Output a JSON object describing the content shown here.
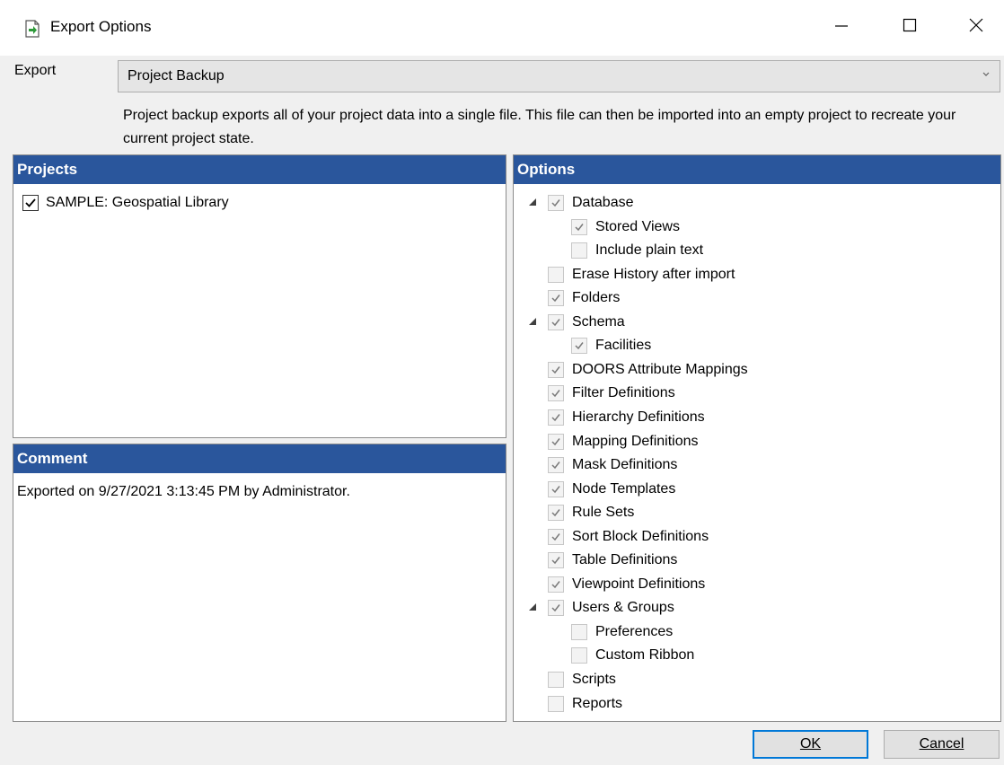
{
  "window": {
    "title": "Export Options",
    "icon": "export-document-icon",
    "minimize_icon": "minimize-icon",
    "maximize_icon": "maximize-icon",
    "close_icon": "close-icon"
  },
  "export": {
    "label": "Export",
    "selected": "Project Backup",
    "description": "Project backup exports all of your project data into a single file. This file can then be imported into an empty project to recreate your current project state."
  },
  "projects": {
    "header": "Projects",
    "items": [
      {
        "label": "SAMPLE: Geospatial Library",
        "checked": true
      }
    ]
  },
  "comment": {
    "header": "Comment",
    "text": "Exported on 9/27/2021 3:13:45 PM by Administrator."
  },
  "options": {
    "header": "Options",
    "items": [
      {
        "label": "Database",
        "checked": true,
        "level": 0,
        "expandable": true
      },
      {
        "label": "Stored Views",
        "checked": true,
        "level": 1,
        "expandable": false
      },
      {
        "label": "Include plain text",
        "checked": false,
        "level": 1,
        "expandable": false
      },
      {
        "label": "Erase History after import",
        "checked": false,
        "level": 0,
        "expandable": false
      },
      {
        "label": "Folders",
        "checked": true,
        "level": 0,
        "expandable": false
      },
      {
        "label": "Schema",
        "checked": true,
        "level": 0,
        "expandable": true
      },
      {
        "label": "Facilities",
        "checked": true,
        "level": 1,
        "expandable": false
      },
      {
        "label": "DOORS Attribute Mappings",
        "checked": true,
        "level": 0,
        "expandable": false
      },
      {
        "label": "Filter Definitions",
        "checked": true,
        "level": 0,
        "expandable": false
      },
      {
        "label": "Hierarchy Definitions",
        "checked": true,
        "level": 0,
        "expandable": false
      },
      {
        "label": "Mapping Definitions",
        "checked": true,
        "level": 0,
        "expandable": false
      },
      {
        "label": "Mask Definitions",
        "checked": true,
        "level": 0,
        "expandable": false
      },
      {
        "label": "Node Templates",
        "checked": true,
        "level": 0,
        "expandable": false
      },
      {
        "label": "Rule Sets",
        "checked": true,
        "level": 0,
        "expandable": false
      },
      {
        "label": "Sort Block Definitions",
        "checked": true,
        "level": 0,
        "expandable": false
      },
      {
        "label": "Table Definitions",
        "checked": true,
        "level": 0,
        "expandable": false
      },
      {
        "label": "Viewpoint Definitions",
        "checked": true,
        "level": 0,
        "expandable": false
      },
      {
        "label": "Users & Groups",
        "checked": true,
        "level": 0,
        "expandable": true
      },
      {
        "label": "Preferences",
        "checked": false,
        "level": 1,
        "expandable": false
      },
      {
        "label": "Custom Ribbon",
        "checked": false,
        "level": 1,
        "expandable": false
      },
      {
        "label": "Scripts",
        "checked": false,
        "level": 0,
        "expandable": false
      },
      {
        "label": "Reports",
        "checked": false,
        "level": 0,
        "expandable": false
      }
    ]
  },
  "buttons": {
    "ok_label": "OK",
    "cancel_label": "Cancel"
  }
}
